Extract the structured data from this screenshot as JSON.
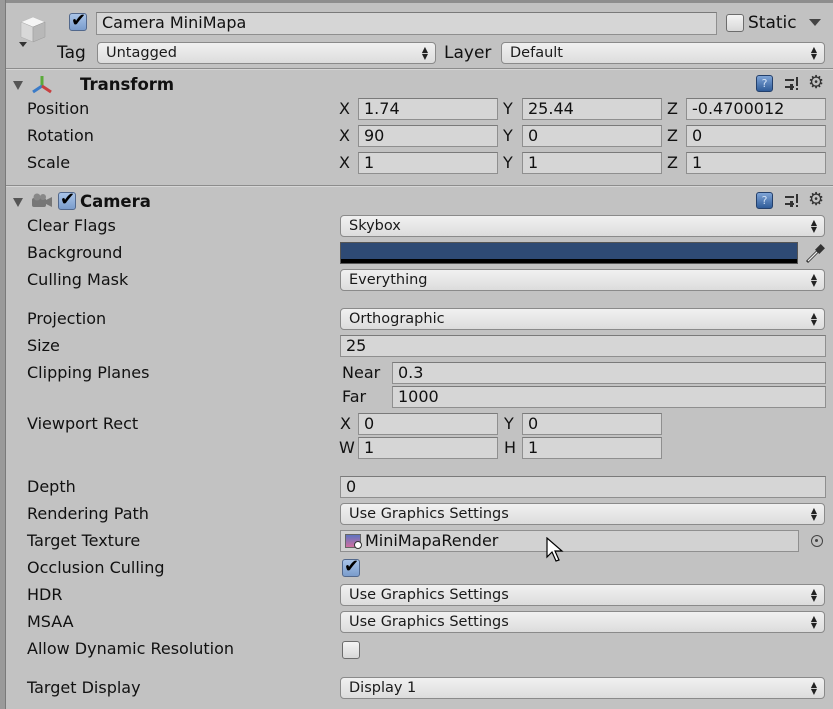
{
  "header": {
    "active": true,
    "object_name": "Camera MiniMapa",
    "static_label": "Static",
    "static_checked": false,
    "tag_label": "Tag",
    "tag_value": "Untagged",
    "layer_label": "Layer",
    "layer_value": "Default"
  },
  "transform": {
    "title": "Transform",
    "rows": [
      {
        "label": "Position",
        "x": "1.74",
        "y": "25.44",
        "z": "-0.4700012"
      },
      {
        "label": "Rotation",
        "x": "90",
        "y": "0",
        "z": "0"
      },
      {
        "label": "Scale",
        "x": "1",
        "y": "1",
        "z": "1"
      }
    ],
    "axis": {
      "x": "X",
      "y": "Y",
      "z": "Z"
    }
  },
  "camera": {
    "title": "Camera",
    "enabled": true,
    "clear_flags": {
      "label": "Clear Flags",
      "value": "Skybox"
    },
    "background": {
      "label": "Background",
      "color": "#2e4a74"
    },
    "culling_mask": {
      "label": "Culling Mask",
      "value": "Everything"
    },
    "projection": {
      "label": "Projection",
      "value": "Orthographic"
    },
    "size": {
      "label": "Size",
      "value": "25"
    },
    "clipping": {
      "label": "Clipping Planes",
      "near_label": "Near",
      "near": "0.3",
      "far_label": "Far",
      "far": "1000"
    },
    "viewport": {
      "label": "Viewport Rect",
      "x_label": "X",
      "x": "0",
      "y_label": "Y",
      "y": "0",
      "w_label": "W",
      "w": "1",
      "h_label": "H",
      "h": "1"
    },
    "depth": {
      "label": "Depth",
      "value": "0"
    },
    "rendering_path": {
      "label": "Rendering Path",
      "value": "Use Graphics Settings"
    },
    "target_texture": {
      "label": "Target Texture",
      "value": "MiniMapaRender"
    },
    "occlusion_culling": {
      "label": "Occlusion Culling",
      "checked": true
    },
    "hdr": {
      "label": "HDR",
      "value": "Use Graphics Settings"
    },
    "msaa": {
      "label": "MSAA",
      "value": "Use Graphics Settings"
    },
    "dynamic_resolution": {
      "label": "Allow Dynamic Resolution",
      "checked": false
    },
    "target_display": {
      "label": "Target Display",
      "value": "Display 1"
    }
  },
  "icons": {
    "help": "?",
    "gear": "⚙",
    "tick": "✔",
    "arrows": "▲▼"
  }
}
